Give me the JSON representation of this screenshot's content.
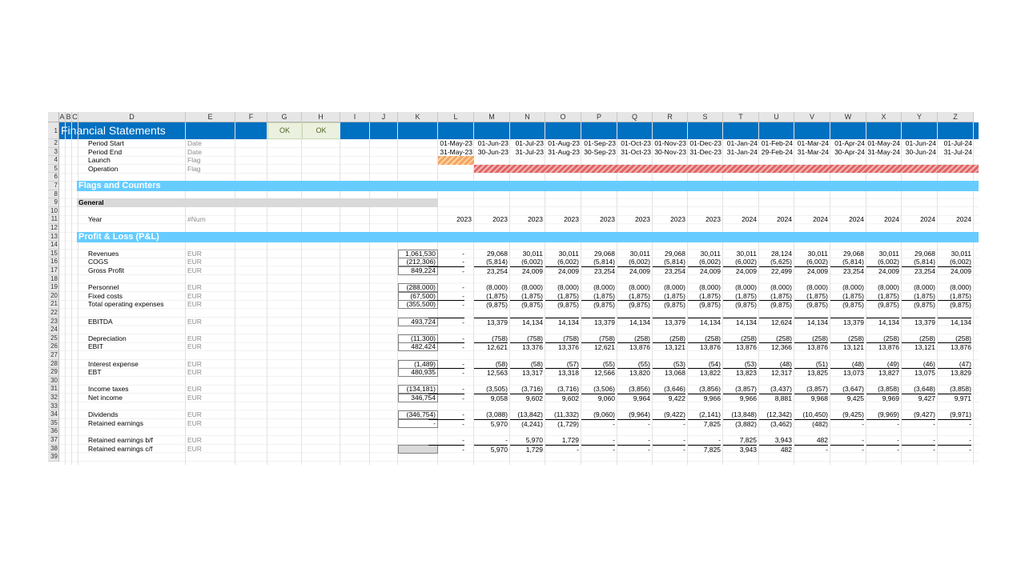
{
  "columns": [
    "A",
    "B",
    "C",
    "D",
    "E",
    "F",
    "G",
    "H",
    "I",
    "J",
    "K",
    "L",
    "M",
    "N",
    "O",
    "P",
    "Q",
    "R",
    "S",
    "T",
    "U",
    "V",
    "W",
    "X",
    "Y",
    "Z"
  ],
  "rows": [
    "1",
    "2",
    "3",
    "4",
    "5",
    "6",
    "7",
    "8",
    "9",
    "10",
    "11",
    "12",
    "13",
    "14",
    "15",
    "16",
    "17",
    "18",
    "19",
    "20",
    "21",
    "22",
    "23",
    "24",
    "25",
    "26",
    "27",
    "28",
    "29",
    "30",
    "31",
    "32",
    "33",
    "34",
    "35",
    "36",
    "37",
    "38",
    "39"
  ],
  "title": "Financial Statements",
  "checks": [
    "OK",
    "OK"
  ],
  "header_rows": [
    {
      "label": "Period Start",
      "unit": "Date",
      "values": [
        "01-May-23",
        "01-Jun-23",
        "01-Jul-23",
        "01-Aug-23",
        "01-Sep-23",
        "01-Oct-23",
        "01-Nov-23",
        "01-Dec-23",
        "01-Jan-24",
        "01-Feb-24",
        "01-Mar-24",
        "01-Apr-24",
        "01-May-24",
        "01-Jun-24",
        "01-Jul-24"
      ]
    },
    {
      "label": "Period End",
      "unit": "Date",
      "values": [
        "31-May-23",
        "30-Jun-23",
        "31-Jul-23",
        "31-Aug-23",
        "30-Sep-23",
        "31-Oct-23",
        "30-Nov-23",
        "31-Dec-23",
        "31-Jan-24",
        "29-Feb-24",
        "31-Mar-24",
        "30-Apr-24",
        "31-May-24",
        "30-Jun-24",
        "31-Jul-24"
      ]
    },
    {
      "label": "Launch",
      "unit": "Flag"
    },
    {
      "label": "Operation",
      "unit": "Flag"
    }
  ],
  "sections": {
    "flags": "Flags and Counters",
    "general": "General",
    "pnl": "Profit & Loss (P&L)"
  },
  "year_row": {
    "label": "Year",
    "unit": "#Num",
    "values": [
      "2023",
      "2023",
      "2023",
      "2023",
      "2023",
      "2023",
      "2023",
      "2023",
      "2024",
      "2024",
      "2024",
      "2024",
      "2024",
      "2024",
      "2024"
    ]
  },
  "pnl_rows": [
    {
      "row": 15,
      "label": "Revenues",
      "unit": "EUR",
      "total": "1,061,530",
      "values": [
        "-",
        "29,068",
        "30,011",
        "30,011",
        "29,068",
        "30,011",
        "29,068",
        "30,011",
        "30,011",
        "28,124",
        "30,011",
        "29,068",
        "30,011",
        "29,068",
        "30,011"
      ]
    },
    {
      "row": 16,
      "label": "COGS",
      "unit": "EUR",
      "total": "(212,306)",
      "values": [
        "-",
        "(5,814)",
        "(6,002)",
        "(6,002)",
        "(5,814)",
        "(6,002)",
        "(5,814)",
        "(6,002)",
        "(6,002)",
        "(5,625)",
        "(6,002)",
        "(5,814)",
        "(6,002)",
        "(5,814)",
        "(6,002)"
      ]
    },
    {
      "row": 17,
      "label": "Gross Profit",
      "unit": "EUR",
      "total": "849,224",
      "values": [
        "-",
        "23,254",
        "24,009",
        "24,009",
        "23,254",
        "24,009",
        "23,254",
        "24,009",
        "24,009",
        "22,499",
        "24,009",
        "23,254",
        "24,009",
        "23,254",
        "24,009"
      ]
    },
    {
      "row": 19,
      "label": "Personnel",
      "unit": "EUR",
      "total": "(288,000)",
      "values": [
        "-",
        "(8,000)",
        "(8,000)",
        "(8,000)",
        "(8,000)",
        "(8,000)",
        "(8,000)",
        "(8,000)",
        "(8,000)",
        "(8,000)",
        "(8,000)",
        "(8,000)",
        "(8,000)",
        "(8,000)",
        "(8,000)"
      ]
    },
    {
      "row": 20,
      "label": "Fixed costs",
      "unit": "EUR",
      "total": "(67,500)",
      "values": [
        "-",
        "(1,875)",
        "(1,875)",
        "(1,875)",
        "(1,875)",
        "(1,875)",
        "(1,875)",
        "(1,875)",
        "(1,875)",
        "(1,875)",
        "(1,875)",
        "(1,875)",
        "(1,875)",
        "(1,875)",
        "(1,875)"
      ]
    },
    {
      "row": 21,
      "label": "Total operating expenses",
      "unit": "EUR",
      "total": "(355,500)",
      "values": [
        "-",
        "(9,875)",
        "(9,875)",
        "(9,875)",
        "(9,875)",
        "(9,875)",
        "(9,875)",
        "(9,875)",
        "(9,875)",
        "(9,875)",
        "(9,875)",
        "(9,875)",
        "(9,875)",
        "(9,875)",
        "(9,875)"
      ]
    },
    {
      "row": 23,
      "label": "EBITDA",
      "unit": "EUR",
      "total": "493,724",
      "values": [
        "-",
        "13,379",
        "14,134",
        "14,134",
        "13,379",
        "14,134",
        "13,379",
        "14,134",
        "14,134",
        "12,624",
        "14,134",
        "13,379",
        "14,134",
        "13,379",
        "14,134"
      ]
    },
    {
      "row": 25,
      "label": "Depreciation",
      "unit": "EUR",
      "total": "(11,300)",
      "values": [
        "-",
        "(758)",
        "(758)",
        "(758)",
        "(758)",
        "(258)",
        "(258)",
        "(258)",
        "(258)",
        "(258)",
        "(258)",
        "(258)",
        "(258)",
        "(258)",
        "(258)"
      ]
    },
    {
      "row": 26,
      "label": "EBIT",
      "unit": "EUR",
      "total": "482,424",
      "values": [
        "-",
        "12,621",
        "13,376",
        "13,376",
        "12,621",
        "13,876",
        "13,121",
        "13,876",
        "13,876",
        "12,366",
        "13,876",
        "13,121",
        "13,876",
        "13,121",
        "13,876"
      ]
    },
    {
      "row": 28,
      "label": "Interest expense",
      "unit": "EUR",
      "total": "(1,489)",
      "values": [
        "-",
        "(58)",
        "(58)",
        "(57)",
        "(55)",
        "(55)",
        "(53)",
        "(54)",
        "(53)",
        "(48)",
        "(51)",
        "(48)",
        "(49)",
        "(46)",
        "(47)"
      ]
    },
    {
      "row": 29,
      "label": "EBT",
      "unit": "EUR",
      "total": "480,935",
      "values": [
        "-",
        "12,563",
        "13,317",
        "13,318",
        "12,566",
        "13,820",
        "13,068",
        "13,822",
        "13,823",
        "12,317",
        "13,825",
        "13,073",
        "13,827",
        "13,075",
        "13,829"
      ]
    },
    {
      "row": 31,
      "label": "Income taxes",
      "unit": "EUR",
      "total": "(134,181)",
      "values": [
        "-",
        "(3,505)",
        "(3,716)",
        "(3,716)",
        "(3,506)",
        "(3,856)",
        "(3,646)",
        "(3,856)",
        "(3,857)",
        "(3,437)",
        "(3,857)",
        "(3,647)",
        "(3,858)",
        "(3,648)",
        "(3,858)"
      ]
    },
    {
      "row": 32,
      "label": "Net income",
      "unit": "EUR",
      "total": "346,754",
      "values": [
        "-",
        "9,058",
        "9,602",
        "9,602",
        "9,060",
        "9,964",
        "9,422",
        "9,966",
        "9,966",
        "8,881",
        "9,968",
        "9,425",
        "9,969",
        "9,427",
        "9,971"
      ]
    },
    {
      "row": 34,
      "label": "Dividends",
      "unit": "EUR",
      "total": "(346,754)",
      "values": [
        "-",
        "(3,088)",
        "(13,842)",
        "(11,332)",
        "(9,060)",
        "(9,964)",
        "(9,422)",
        "(2,141)",
        "(13,848)",
        "(12,342)",
        "(10,450)",
        "(9,425)",
        "(9,969)",
        "(9,427)",
        "(9,971)"
      ]
    },
    {
      "row": 35,
      "label": "Retained earnings",
      "unit": "EUR",
      "total": "-",
      "values": [
        "-",
        "5,970",
        "(4,241)",
        "(1,729)",
        "-",
        "-",
        "-",
        "7,825",
        "(3,882)",
        "(3,462)",
        "(482)",
        "-",
        "-",
        "-",
        "-"
      ]
    },
    {
      "row": 37,
      "label": "Retained earnings b/f",
      "unit": "EUR",
      "total": "",
      "values": [
        "-",
        "-",
        "5,970",
        "1,729",
        "-",
        "-",
        "-",
        "-",
        "7,825",
        "3,943",
        "482",
        "-",
        "-",
        "-",
        "-"
      ]
    },
    {
      "row": 38,
      "label": "Retained earnings c/f",
      "unit": "EUR",
      "total": "",
      "values": [
        "-",
        "5,970",
        "1,729",
        "-",
        "-",
        "-",
        "-",
        "7,825",
        "3,943",
        "482",
        "-",
        "-",
        "-",
        "-",
        "-"
      ]
    }
  ],
  "colors": {
    "title_bar": "#0070c0",
    "section_bar": "#66ccff",
    "general_bar": "#d9d9d9",
    "launch_flag": "#f4a460",
    "operation_flag": "#e06666",
    "ok_fill": "#ebf1de"
  }
}
